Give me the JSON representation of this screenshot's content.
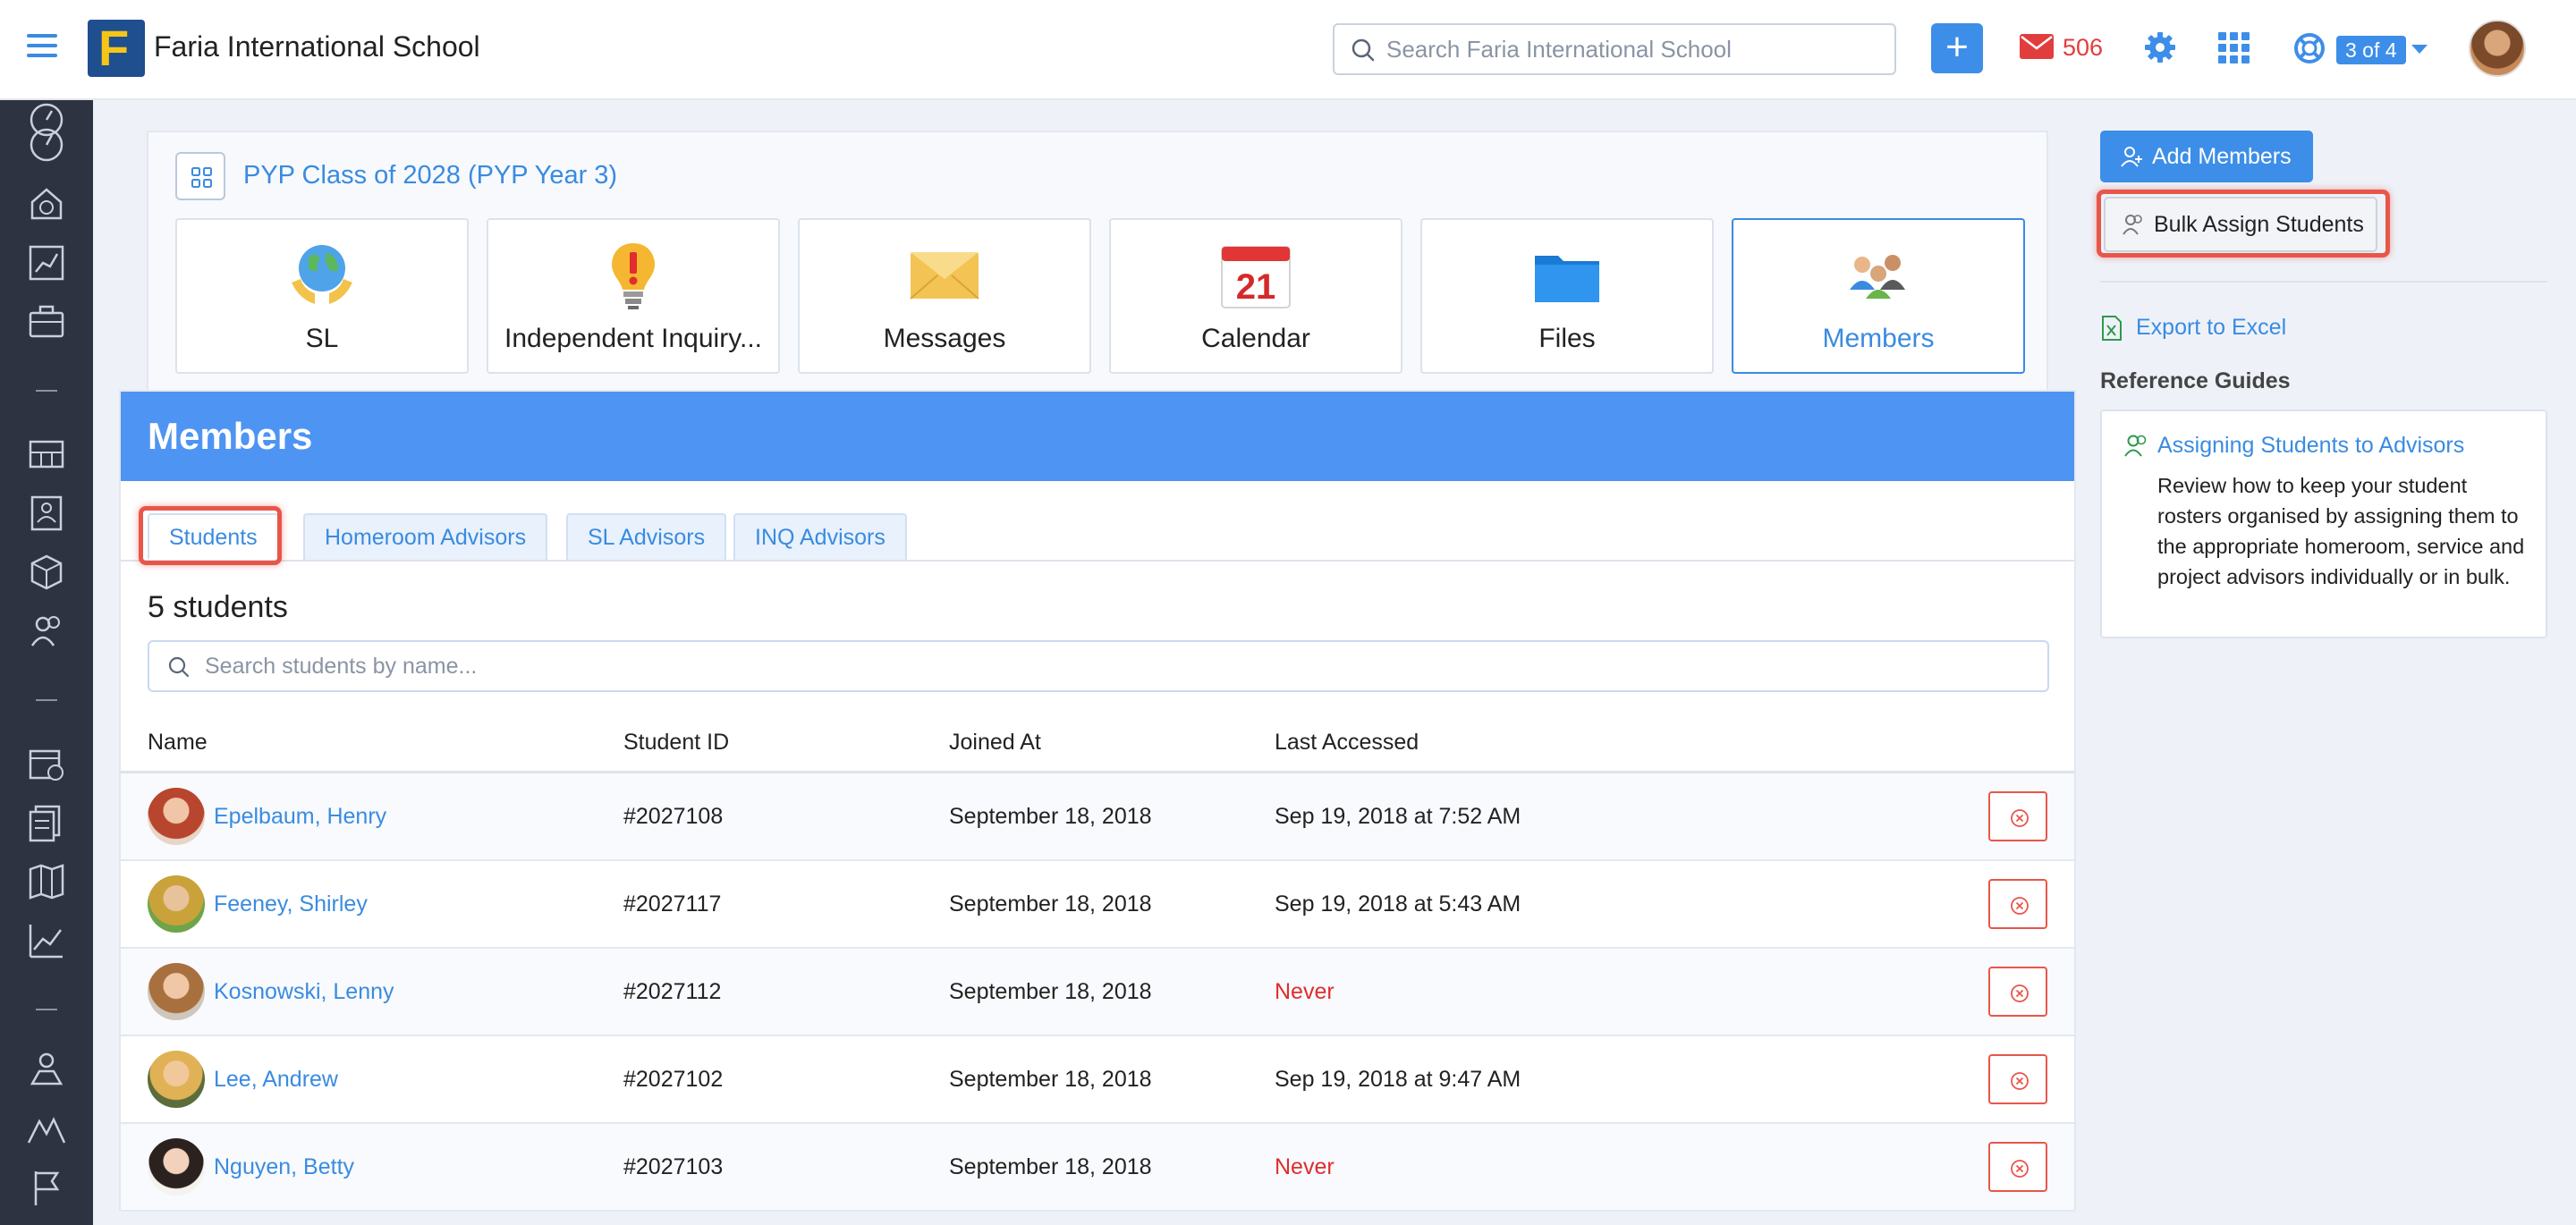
{
  "topbar": {
    "school_name": "Faria International School",
    "search_placeholder": "Search Faria International School",
    "add_label": "+",
    "mail_count": "506",
    "help_badge": "3 of 4",
    "logo_letter": "F"
  },
  "class": {
    "title": "PYP Class of 2028 (PYP Year 3)",
    "tiles": [
      {
        "label": "SL",
        "icon": "globe-hands-icon"
      },
      {
        "label": "Independent Inquiry...",
        "icon": "lightbulb-icon"
      },
      {
        "label": "Messages",
        "icon": "envelope-icon"
      },
      {
        "label": "Calendar",
        "icon": "calendar-icon",
        "date": "21"
      },
      {
        "label": "Files",
        "icon": "folder-icon"
      },
      {
        "label": "Members",
        "icon": "people-icon",
        "active": true
      }
    ]
  },
  "members": {
    "banner": "Members",
    "tabs": [
      "Students",
      "Homeroom Advisors",
      "SL Advisors",
      "INQ Advisors"
    ],
    "active_tab": "Students",
    "count_label": "5 students",
    "search_placeholder": "Search students by name...",
    "columns": [
      "Name",
      "Student ID",
      "Joined At",
      "Last Accessed"
    ],
    "rows": [
      {
        "name": "Epelbaum, Henry",
        "id": "#2027108",
        "joined": "September 18, 2018",
        "last": "Sep 19, 2018 at 7:52 AM",
        "never": false
      },
      {
        "name": "Feeney, Shirley",
        "id": "#2027117",
        "joined": "September 18, 2018",
        "last": "Sep 19, 2018 at 5:43 AM",
        "never": false
      },
      {
        "name": "Kosnowski, Lenny",
        "id": "#2027112",
        "joined": "September 18, 2018",
        "last": "Never",
        "never": true
      },
      {
        "name": "Lee, Andrew",
        "id": "#2027102",
        "joined": "September 18, 2018",
        "last": "Sep 19, 2018 at 9:47 AM",
        "never": false
      },
      {
        "name": "Nguyen, Betty",
        "id": "#2027103",
        "joined": "September 18, 2018",
        "last": "Never",
        "never": true
      }
    ]
  },
  "right": {
    "add_members": "Add Members",
    "bulk_assign": "Bulk Assign Students",
    "export": "Export to Excel",
    "ref_title": "Reference Guides",
    "ref_link": "Assigning Students to Advisors",
    "ref_desc": "Review how to keep your student rosters organised by assigning them to the appropriate homeroom, service and project advisors individually or in bulk."
  },
  "colors": {
    "accent": "#3a8be0",
    "banner": "#4e94f2",
    "danger": "#e02d2d",
    "highlight": "#e8564a",
    "sidebar": "#2d3340"
  }
}
